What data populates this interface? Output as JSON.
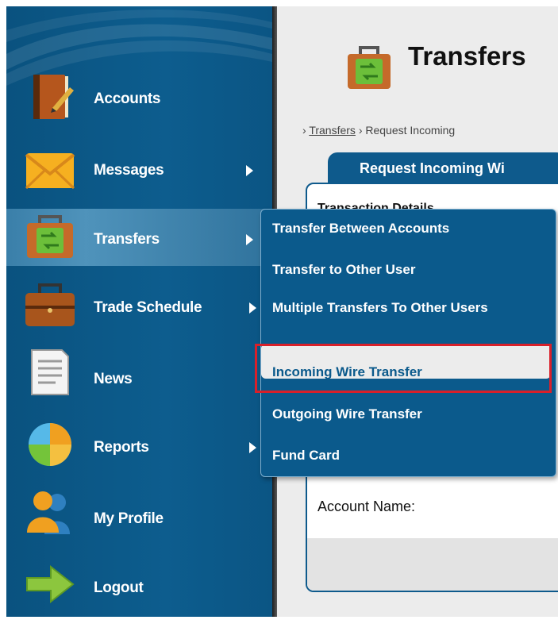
{
  "sidebar": {
    "items": [
      {
        "label": "Accounts",
        "icon": "address-book-icon",
        "has_submenu": false
      },
      {
        "label": "Messages",
        "icon": "envelope-icon",
        "has_submenu": true
      },
      {
        "label": "Transfers",
        "icon": "transfer-briefcase-icon",
        "has_submenu": true,
        "active": true
      },
      {
        "label": "Trade Schedule",
        "icon": "briefcase-icon",
        "has_submenu": true
      },
      {
        "label": "News",
        "icon": "document-icon",
        "has_submenu": false
      },
      {
        "label": "Reports",
        "icon": "pie-chart-icon",
        "has_submenu": true
      },
      {
        "label": "My Profile",
        "icon": "users-icon",
        "has_submenu": false
      },
      {
        "label": "Logout",
        "icon": "arrow-right-icon",
        "has_submenu": false
      }
    ]
  },
  "submenu": {
    "items": [
      {
        "label": "Transfer Between Accounts"
      },
      {
        "label": "Transfer to Other User"
      },
      {
        "label": "Multiple Transfers To Other Users"
      },
      {
        "label": "Incoming Wire Transfer",
        "selected": true
      },
      {
        "label": "Outgoing Wire Transfer"
      },
      {
        "label": "Fund Card"
      }
    ]
  },
  "main": {
    "title": "Transfers",
    "breadcrumb": {
      "sep": "›",
      "link": "Transfers",
      "current": "Request Incoming"
    },
    "tab_label": "Request Incoming Wi",
    "section_title": "Transaction Details",
    "field_label": "Account Name:"
  },
  "colors": {
    "sidebar": "#0d5d8e",
    "highlight": "#d9202a",
    "content_bg": "#ececec"
  }
}
